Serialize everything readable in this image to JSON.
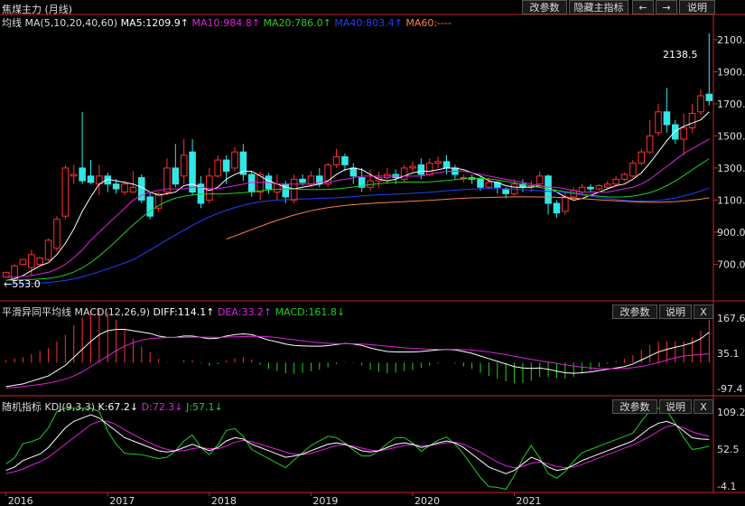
{
  "colors": {
    "up": "#ff3030",
    "down": "#33e6e6",
    "white": "#ffffff",
    "ma10": "#e020e0",
    "ma20": "#20d020",
    "ma40": "#2040ff",
    "ma60": "#ff8040",
    "axis": "#cc2222",
    "text": "#dddddd"
  },
  "toolbar": {
    "params": "改参数",
    "hide": "隐藏主指标",
    "prev": "←",
    "next": "→",
    "help": "说明"
  },
  "main": {
    "title": "焦煤主力 (月线)",
    "ma_label": "均线 MA(5,10,20,40,60)",
    "ma5": "MA5:1209.9↑",
    "ma10": "MA10:984.8↑",
    "ma20": "MA20:786.0↑",
    "ma40": "MA40:803.4↑",
    "ma60": "MA60:----",
    "y_ticks": [
      "2100.0",
      "1900.0",
      "1700.0",
      "1500.0",
      "1300.0",
      "1100.0",
      "900.0",
      "700.0"
    ],
    "high_label": "2138.5",
    "low_label": "553.0"
  },
  "macd": {
    "label": "平滑异同平均线 MACD(12,26,9)",
    "diff": "DIFF:114.1↑",
    "dea": "DEA:33.2↑",
    "macd": "MACD:161.8↓",
    "params": "改参数",
    "help": "说明",
    "close": "X",
    "y_ticks": [
      "167.6",
      "35.1",
      "-97.4"
    ]
  },
  "kdj": {
    "label": "随机指标 KDJ(9,3,3)",
    "k": "K:67.2↓",
    "d": "D:72.3↓",
    "j": "J:57.1↓",
    "params": "改参数",
    "help": "说明",
    "close": "X",
    "y_ticks": [
      "109.2",
      "52.5",
      "-4.1"
    ]
  },
  "x_ticks": [
    "2016",
    "2017",
    "2018",
    "2019",
    "2020",
    "2021"
  ],
  "chart_data": {
    "type": "candlestick",
    "title": "焦煤主力 (月线)",
    "ylim": [
      500,
      2150
    ],
    "ohlc": [
      [
        620,
        650,
        560,
        553
      ],
      [
        600,
        690,
        590,
        700
      ],
      [
        700,
        730,
        690,
        690
      ],
      [
        680,
        760,
        630,
        790
      ],
      [
        700,
        740,
        690,
        720
      ],
      [
        730,
        850,
        720,
        860
      ],
      [
        800,
        980,
        780,
        1000
      ],
      [
        1000,
        1300,
        980,
        1320
      ],
      [
        1250,
        1260,
        1200,
        1320
      ],
      [
        1300,
        1220,
        1200,
        1650
      ],
      [
        1250,
        1210,
        1200,
        1350
      ],
      [
        1200,
        1250,
        1130,
        1320
      ],
      [
        1250,
        1200,
        1150,
        1270
      ],
      [
        1200,
        1170,
        1140,
        1230
      ],
      [
        1150,
        1200,
        1130,
        1220
      ],
      [
        1150,
        1180,
        1150,
        1280
      ],
      [
        1240,
        1100,
        1080,
        1260
      ],
      [
        1120,
        1000,
        980,
        1150
      ],
      [
        1050,
        1140,
        1030,
        1150
      ],
      [
        1150,
        1300,
        1130,
        1360
      ],
      [
        1300,
        1200,
        1180,
        1450
      ],
      [
        1250,
        1380,
        1200,
        1480
      ],
      [
        1400,
        1150,
        1130,
        1480
      ],
      [
        1200,
        1080,
        1050,
        1250
      ],
      [
        1100,
        1250,
        1080,
        1300
      ],
      [
        1250,
        1350,
        1240,
        1380
      ],
      [
        1350,
        1280,
        1200,
        1380
      ],
      [
        1300,
        1400,
        1280,
        1430
      ],
      [
        1400,
        1260,
        1220,
        1450
      ],
      [
        1260,
        1150,
        1120,
        1280
      ],
      [
        1150,
        1260,
        1100,
        1280
      ],
      [
        1250,
        1170,
        1140,
        1270
      ],
      [
        1150,
        1200,
        1100,
        1260
      ],
      [
        1200,
        1120,
        1080,
        1220
      ],
      [
        1100,
        1230,
        1080,
        1260
      ],
      [
        1230,
        1210,
        1190,
        1260
      ],
      [
        1200,
        1250,
        1180,
        1280
      ],
      [
        1250,
        1200,
        1180,
        1300
      ],
      [
        1200,
        1320,
        1180,
        1330
      ],
      [
        1320,
        1370,
        1300,
        1420
      ],
      [
        1370,
        1320,
        1280,
        1390
      ],
      [
        1300,
        1250,
        1200,
        1330
      ],
      [
        1240,
        1180,
        1150,
        1300
      ],
      [
        1180,
        1220,
        1160,
        1290
      ],
      [
        1220,
        1240,
        1180,
        1280
      ],
      [
        1240,
        1260,
        1200,
        1300
      ],
      [
        1260,
        1240,
        1200,
        1290
      ],
      [
        1230,
        1300,
        1210,
        1320
      ],
      [
        1300,
        1310,
        1280,
        1340
      ],
      [
        1320,
        1260,
        1230,
        1360
      ],
      [
        1260,
        1330,
        1250,
        1360
      ],
      [
        1330,
        1340,
        1300,
        1370
      ],
      [
        1340,
        1300,
        1260,
        1380
      ],
      [
        1300,
        1260,
        1230,
        1320
      ],
      [
        1240,
        1240,
        1210,
        1260
      ],
      [
        1240,
        1230,
        1200,
        1260
      ],
      [
        1230,
        1180,
        1160,
        1250
      ],
      [
        1180,
        1210,
        1170,
        1240
      ],
      [
        1210,
        1180,
        1140,
        1220
      ],
      [
        1170,
        1140,
        1110,
        1180
      ],
      [
        1140,
        1200,
        1130,
        1230
      ],
      [
        1200,
        1180,
        1150,
        1230
      ],
      [
        1180,
        1190,
        1150,
        1220
      ],
      [
        1200,
        1250,
        1180,
        1280
      ],
      [
        1250,
        1080,
        1010,
        1260
      ],
      [
        1080,
        1020,
        990,
        1100
      ],
      [
        1030,
        1120,
        1010,
        1150
      ],
      [
        1120,
        1160,
        1110,
        1180
      ],
      [
        1150,
        1180,
        1140,
        1200
      ],
      [
        1180,
        1170,
        1150,
        1200
      ],
      [
        1170,
        1190,
        1160,
        1200
      ],
      [
        1180,
        1200,
        1170,
        1220
      ],
      [
        1200,
        1230,
        1190,
        1250
      ],
      [
        1230,
        1260,
        1220,
        1270
      ],
      [
        1250,
        1330,
        1240,
        1350
      ],
      [
        1330,
        1400,
        1320,
        1420
      ],
      [
        1400,
        1500,
        1390,
        1600
      ],
      [
        1520,
        1650,
        1500,
        1700
      ],
      [
        1650,
        1570,
        1520,
        1800
      ],
      [
        1570,
        1480,
        1450,
        1600
      ],
      [
        1480,
        1550,
        1380,
        1640
      ],
      [
        1550,
        1640,
        1520,
        1700
      ],
      [
        1650,
        1750,
        1630,
        1790
      ],
      [
        1760,
        1720,
        1690,
        2138.5
      ]
    ],
    "ma5": [
      600,
      610,
      630,
      660,
      690,
      710,
      760,
      830,
      920,
      1030,
      1120,
      1200,
      1230,
      1220,
      1210,
      1200,
      1180,
      1150,
      1130,
      1140,
      1150,
      1190,
      1200,
      1180,
      1160,
      1180,
      1230,
      1260,
      1280,
      1280,
      1250,
      1220,
      1200,
      1180,
      1170,
      1180,
      1190,
      1200,
      1220,
      1260,
      1290,
      1300,
      1290,
      1260,
      1230,
      1220,
      1230,
      1250,
      1270,
      1280,
      1280,
      1290,
      1300,
      1300,
      1290,
      1270,
      1250,
      1220,
      1210,
      1190,
      1180,
      1180,
      1180,
      1190,
      1180,
      1150,
      1120,
      1100,
      1110,
      1130,
      1150,
      1170,
      1190,
      1200,
      1230,
      1270,
      1330,
      1400,
      1470,
      1530,
      1560,
      1580,
      1600,
      1650
    ],
    "ma10": [
      620,
      620,
      625,
      630,
      640,
      650,
      670,
      700,
      740,
      790,
      850,
      900,
      950,
      1000,
      1050,
      1100,
      1130,
      1150,
      1160,
      1170,
      1170,
      1170,
      1180,
      1180,
      1170,
      1170,
      1180,
      1190,
      1200,
      1210,
      1210,
      1210,
      1200,
      1200,
      1200,
      1200,
      1200,
      1210,
      1210,
      1220,
      1230,
      1240,
      1250,
      1250,
      1250,
      1250,
      1250,
      1250,
      1250,
      1250,
      1260,
      1270,
      1280,
      1280,
      1280,
      1270,
      1260,
      1250,
      1240,
      1230,
      1220,
      1210,
      1200,
      1190,
      1180,
      1180,
      1170,
      1160,
      1150,
      1150,
      1150,
      1150,
      1160,
      1170,
      1180,
      1200,
      1230,
      1270,
      1310,
      1350,
      1390,
      1420,
      1450,
      1480
    ],
    "macd_diff": [
      -90,
      -85,
      -80,
      -70,
      -60,
      -50,
      -30,
      -10,
      20,
      50,
      80,
      105,
      120,
      125,
      125,
      120,
      115,
      110,
      100,
      95,
      95,
      100,
      100,
      95,
      90,
      92,
      100,
      105,
      108,
      105,
      95,
      85,
      78,
      70,
      65,
      63,
      62,
      62,
      64,
      68,
      72,
      70,
      65,
      55,
      48,
      42,
      40,
      40,
      40,
      42,
      45,
      48,
      50,
      48,
      42,
      35,
      25,
      15,
      5,
      -5,
      -15,
      -20,
      -22,
      -20,
      -25,
      -32,
      -38,
      -40,
      -38,
      -35,
      -30,
      -25,
      -20,
      -15,
      -5,
      10,
      25,
      40,
      50,
      58,
      65,
      75,
      90,
      114.1
    ],
    "macd_dea": [
      -95,
      -93,
      -90,
      -86,
      -82,
      -77,
      -70,
      -62,
      -50,
      -35,
      -15,
      5,
      25,
      45,
      62,
      75,
      85,
      90,
      93,
      94,
      95,
      95,
      96,
      96,
      96,
      95,
      96,
      97,
      98,
      99,
      99,
      97,
      94,
      90,
      86,
      82,
      78,
      75,
      73,
      71,
      71,
      71,
      70,
      68,
      65,
      62,
      59,
      56,
      54,
      52,
      51,
      50,
      50,
      50,
      49,
      47,
      44,
      40,
      35,
      30,
      24,
      18,
      12,
      7,
      2,
      -3,
      -8,
      -13,
      -17,
      -20,
      -22,
      -23,
      -23,
      -22,
      -19,
      -14,
      -8,
      0,
      10,
      18,
      25,
      28,
      30,
      33.2
    ],
    "kdj_k": [
      20,
      25,
      35,
      40,
      45,
      55,
      70,
      85,
      95,
      100,
      105,
      100,
      90,
      80,
      70,
      65,
      60,
      55,
      50,
      48,
      50,
      55,
      60,
      55,
      50,
      55,
      65,
      70,
      68,
      60,
      55,
      50,
      45,
      40,
      42,
      45,
      50,
      55,
      60,
      62,
      60,
      55,
      50,
      48,
      50,
      55,
      60,
      62,
      60,
      55,
      58,
      62,
      65,
      62,
      55,
      45,
      35,
      25,
      20,
      15,
      20,
      30,
      40,
      35,
      25,
      20,
      22,
      28,
      35,
      40,
      45,
      50,
      55,
      60,
      65,
      75,
      85,
      92,
      95,
      90,
      80,
      70,
      68,
      67.2
    ],
    "kdj_d": [
      15,
      18,
      22,
      28,
      33,
      40,
      50,
      60,
      70,
      80,
      90,
      95,
      95,
      90,
      82,
      75,
      68,
      62,
      56,
      52,
      50,
      50,
      53,
      55,
      53,
      53,
      57,
      63,
      66,
      64,
      60,
      56,
      52,
      48,
      45,
      44,
      46,
      50,
      54,
      58,
      59,
      57,
      54,
      51,
      50,
      52,
      55,
      58,
      59,
      58,
      58,
      60,
      62,
      63,
      60,
      54,
      48,
      40,
      33,
      27,
      24,
      26,
      31,
      33,
      30,
      26,
      24,
      25,
      29,
      34,
      39,
      44,
      49,
      54,
      59,
      65,
      72,
      80,
      87,
      89,
      85,
      79,
      75,
      72.3
    ]
  }
}
